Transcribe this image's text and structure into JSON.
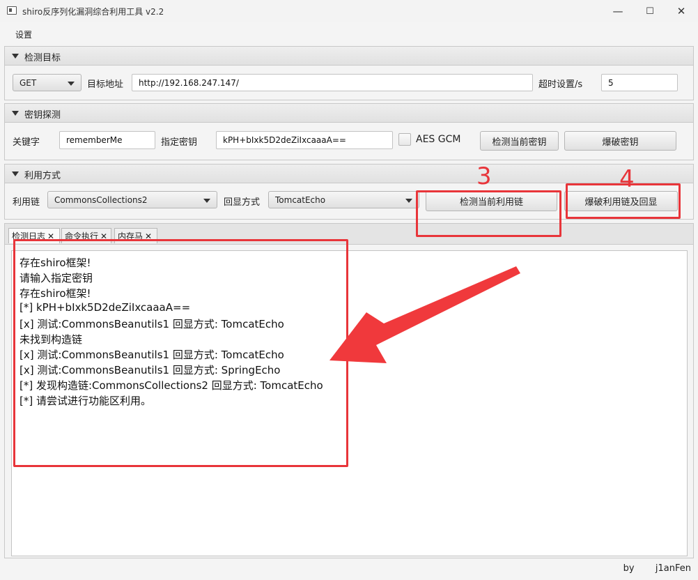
{
  "window": {
    "title": "shiro反序列化漏洞综合利用工具 v2.2",
    "minimize": "—",
    "maximize": "☐",
    "close": "✕"
  },
  "menu": {
    "settings": "设置"
  },
  "target": {
    "section_title": "检测目标",
    "method": "GET",
    "url_label": "目标地址",
    "url": "http://192.168.247.147/",
    "timeout_label": "超时设置/s",
    "timeout": "5"
  },
  "key": {
    "section_title": "密钥探测",
    "keyword_label": "关键字",
    "keyword": "rememberMe",
    "key_label": "指定密钥",
    "key_value": "kPH+bIxk5D2deZiIxcaaaA==",
    "aes_gcm_label": "AES GCM",
    "aes_gcm_checked": false,
    "check_button": "检测当前密钥",
    "brute_button": "爆破密钥"
  },
  "exploit": {
    "section_title": "利用方式",
    "chain_label": "利用链",
    "chain": "CommonsCollections2",
    "echo_label": "回显方式",
    "echo": "TomcatEcho",
    "check_button": "检测当前利用链",
    "brute_button": "爆破利用链及回显"
  },
  "tabs": [
    {
      "label": "检测日志"
    },
    {
      "label": "命令执行"
    },
    {
      "label": "内存马"
    }
  ],
  "log_lines": [
    "存在shiro框架!",
    "请输入指定密钥",
    "存在shiro框架!",
    "[*] kPH+bIxk5D2deZiIxcaaaA==",
    "[x] 测试:CommonsBeanutils1  回显方式: TomcatEcho",
    "未找到构造链",
    "[x] 测试:CommonsBeanutils1  回显方式: TomcatEcho",
    "[x] 测试:CommonsBeanutils1  回显方式: SpringEcho",
    "[*] 发现构造链:CommonsCollections2  回显方式: TomcatEcho",
    "[*] 请尝试进行功能区利用。"
  ],
  "footer": {
    "by": "by",
    "author": "j1anFen"
  },
  "annotations": {
    "num_3": "3",
    "num_4": "4",
    "color": "#e8353a"
  }
}
